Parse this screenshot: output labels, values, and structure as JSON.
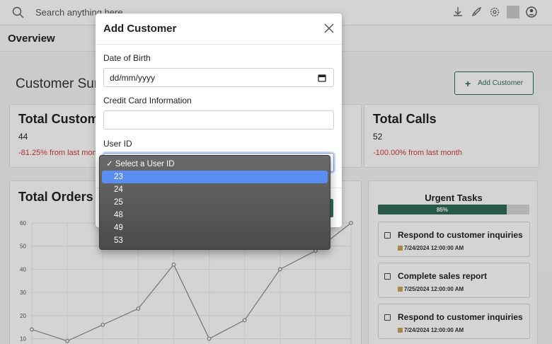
{
  "topbar": {
    "search_placeholder": "Search anything here"
  },
  "subbar": {
    "tab_overview": "Overview"
  },
  "summary": {
    "title": "Customer Summary",
    "add_customer_label": "Add Customer"
  },
  "cards": {
    "total_customers": {
      "title": "Total Customers",
      "value": "44",
      "delta": "-81.25% from last month"
    },
    "total_calls": {
      "title": "Total Calls",
      "value": "52",
      "delta": "-100.00% from last month"
    }
  },
  "orders": {
    "title": "Total Orders"
  },
  "chart_data": {
    "type": "line",
    "ylim": [
      0,
      60
    ],
    "yticks": [
      "60",
      "50",
      "40",
      "30",
      "20",
      "10"
    ],
    "x": [
      1,
      2,
      3,
      4,
      5,
      6,
      7,
      8,
      9,
      10
    ],
    "values": [
      14,
      9,
      16,
      23,
      42,
      10,
      18,
      40,
      48,
      60
    ]
  },
  "tasks": {
    "title": "Urgent Tasks",
    "progress": 85,
    "progress_label": "85%",
    "items": [
      {
        "name": "Respond to customer inquiries",
        "date": "7/24/2024 12:00:00 AM"
      },
      {
        "name": "Complete sales report",
        "date": "7/25/2024 12:00:00 AM"
      },
      {
        "name": "Respond to customer inquiries",
        "date": "7/24/2024 12:00:00 AM"
      }
    ]
  },
  "modal": {
    "title": "Add Customer",
    "dob_label": "Date of Birth",
    "dob_value": "dd/mm/yyyy",
    "cc_label": "Credit Card Information",
    "cc_value": "",
    "userid_label": "User ID"
  },
  "dropdown": {
    "placeholder": "✓ Select a User ID",
    "options": [
      "23",
      "24",
      "25",
      "48",
      "49",
      "53"
    ],
    "highlighted": "23"
  },
  "colors": {
    "accent": "#2e6b55",
    "danger": "#d23b3b",
    "highlight": "#5a8ef2"
  }
}
